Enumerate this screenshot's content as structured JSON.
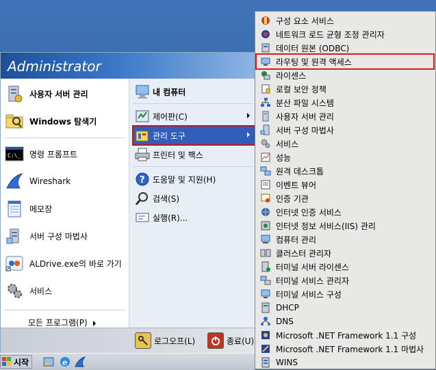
{
  "user": {
    "name": "Administrator"
  },
  "pinned": [
    {
      "label": "사용자 서버 관리",
      "icon": "server-manager-icon",
      "bold": true
    },
    {
      "label": "Windows 탐색기",
      "icon": "explorer-icon",
      "bold": true
    }
  ],
  "recent": [
    {
      "label": "명령 프롬프트",
      "icon": "cmd-icon"
    },
    {
      "label": "Wireshark",
      "icon": "wireshark-icon"
    },
    {
      "label": "메모장",
      "icon": "notepad-icon"
    },
    {
      "label": "서버 구성 마법사",
      "icon": "wizard-icon"
    },
    {
      "label": "ALDrive.exe의 바로 가기",
      "icon": "aldrive-icon"
    },
    {
      "label": "서비스",
      "icon": "services-icon"
    }
  ],
  "all_programs": "모든 프로그램(P)",
  "right": [
    {
      "label": "내 컴퓨터",
      "icon": "my-computer-icon",
      "bold": true
    },
    {
      "label": "제어판(C)",
      "icon": "control-panel-icon",
      "arrow": true
    },
    {
      "label": "관리 도구",
      "icon": "admin-tools-icon",
      "arrow": true,
      "highlight": true
    },
    {
      "label": "프린터 및 팩스",
      "icon": "printer-icon"
    },
    {
      "label": "도움말 및 지원(H)",
      "icon": "help-icon"
    },
    {
      "label": "검색(S)",
      "icon": "search-icon"
    },
    {
      "label": "실행(R)...",
      "icon": "run-icon"
    }
  ],
  "footer": {
    "logoff": "로그오프(L)",
    "shutdown": "종료(U)"
  },
  "submenu": [
    {
      "label": "구성 요소 서비스",
      "icon": "component-services-icon"
    },
    {
      "label": "네트워크 로드 균형 조정 관리자",
      "icon": "nlb-icon"
    },
    {
      "label": "데이터 원본 (ODBC)",
      "icon": "odbc-icon"
    },
    {
      "label": "라우팅 및 원격 액세스",
      "icon": "routing-icon",
      "boxed": true
    },
    {
      "label": "라이센스",
      "icon": "license-icon"
    },
    {
      "label": "로컬 보안 정책",
      "icon": "local-security-icon"
    },
    {
      "label": "분산 파일 시스템",
      "icon": "dfs-icon"
    },
    {
      "label": "사용자 서버 관리",
      "icon": "server-manager-icon"
    },
    {
      "label": "서버 구성 마법사",
      "icon": "wizard-icon"
    },
    {
      "label": "서비스",
      "icon": "services-icon"
    },
    {
      "label": "성능",
      "icon": "performance-icon"
    },
    {
      "label": "원격 데스크톱",
      "icon": "remote-desktop-icon"
    },
    {
      "label": "이벤트 뷰어",
      "icon": "event-viewer-icon"
    },
    {
      "label": "인증 기관",
      "icon": "certificate-icon"
    },
    {
      "label": "인터넷 인증 서비스",
      "icon": "ias-icon"
    },
    {
      "label": "인터넷 정보 서비스(IIS) 관리",
      "icon": "iis-icon"
    },
    {
      "label": "컴퓨터 관리",
      "icon": "computer-management-icon"
    },
    {
      "label": "클러스터 관리자",
      "icon": "cluster-icon"
    },
    {
      "label": "터미널 서버 라이센스",
      "icon": "ts-license-icon"
    },
    {
      "label": "터미널 서비스 관리자",
      "icon": "ts-manager-icon"
    },
    {
      "label": "터미널 서비스 구성",
      "icon": "ts-config-icon"
    },
    {
      "label": "DHCP",
      "icon": "dhcp-icon"
    },
    {
      "label": "DNS",
      "icon": "dns-icon"
    },
    {
      "label": "Microsoft .NET Framework 1.1 구성",
      "icon": "dotnet-icon"
    },
    {
      "label": "Microsoft .NET Framework 1.1 마법사",
      "icon": "dotnet-wizard-icon"
    },
    {
      "label": "WINS",
      "icon": "wins-icon"
    }
  ],
  "taskbar": {
    "start": "시작"
  }
}
